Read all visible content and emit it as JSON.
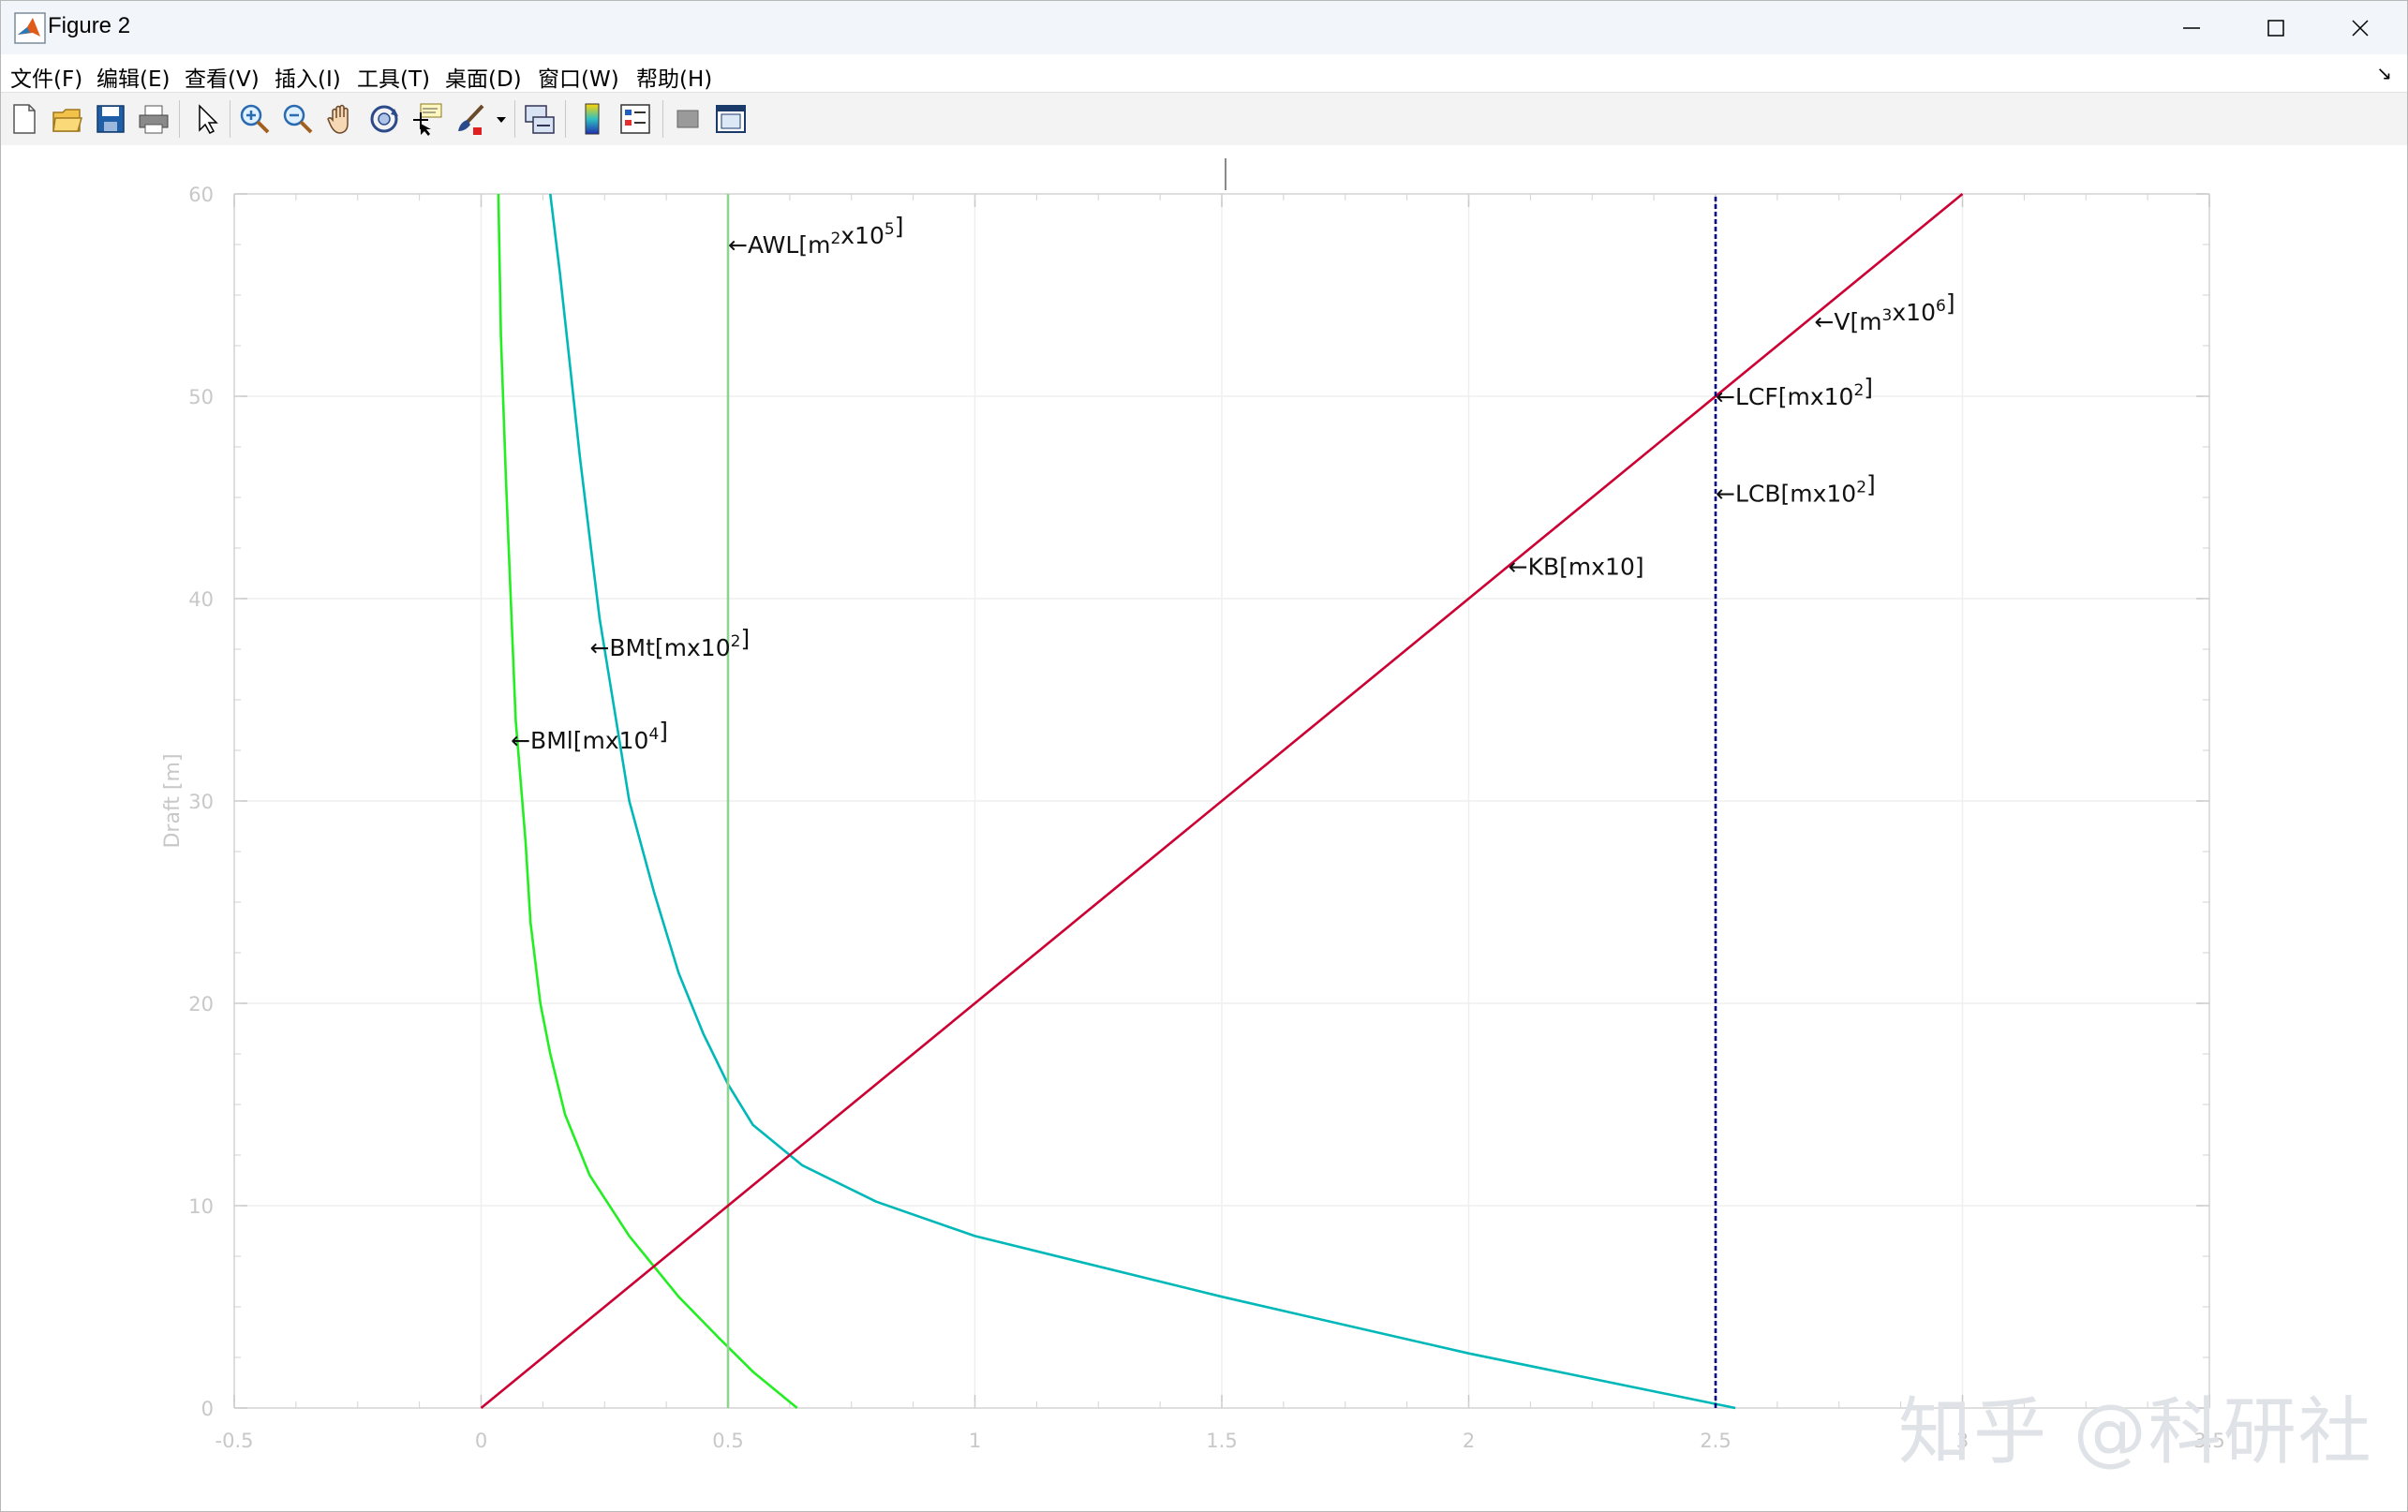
{
  "window": {
    "title": "Figure 2"
  },
  "menu": {
    "items": [
      "文件(F)",
      "编辑(E)",
      "查看(V)",
      "插入(I)",
      "工具(T)",
      "桌面(D)",
      "窗口(W)",
      "帮助(H)"
    ]
  },
  "toolbar": {
    "buttons": [
      {
        "name": "new-figure-icon"
      },
      {
        "name": "open-file-icon"
      },
      {
        "name": "save-icon"
      },
      {
        "name": "print-icon"
      },
      {
        "name": "edit-plot-arrow-icon"
      },
      {
        "name": "zoom-in-icon"
      },
      {
        "name": "zoom-out-icon"
      },
      {
        "name": "pan-hand-icon"
      },
      {
        "name": "rotate-3d-icon"
      },
      {
        "name": "data-cursor-icon"
      },
      {
        "name": "brush-icon"
      },
      {
        "name": "link-plot-icon"
      },
      {
        "name": "colorbar-icon"
      },
      {
        "name": "legend-icon"
      },
      {
        "name": "hide-tools-icon"
      },
      {
        "name": "show-tools-icon"
      }
    ]
  },
  "watermark": "知乎 @科研社",
  "chart_data": {
    "type": "line",
    "xlabel": "",
    "ylabel": "Draft [m]",
    "xlim": [
      -0.5,
      3.5
    ],
    "ylim": [
      0,
      60
    ],
    "xticks": [
      -0.5,
      0,
      0.5,
      1,
      1.5,
      2,
      2.5,
      3,
      3.5
    ],
    "xtick_labels": [
      "-0.5",
      "0",
      "0.5",
      "1",
      "1.5",
      "2",
      "2.5",
      "3",
      "3.5"
    ],
    "yticks": [
      0,
      10,
      20,
      30,
      40,
      50,
      60
    ],
    "ytick_labels": [
      "0",
      "10",
      "20",
      "30",
      "40",
      "50",
      "60"
    ],
    "grid": true,
    "series": [
      {
        "color": "#00b8b8",
        "x": [
          2.54,
          2.0,
          1.5,
          1.0,
          0.8,
          0.65,
          0.55,
          0.5,
          0.45,
          0.4,
          0.35,
          0.3,
          0.27,
          0.24,
          0.22,
          0.2,
          0.18,
          0.16,
          0.14
        ],
        "y": [
          0,
          2.7,
          5.5,
          8.5,
          10.2,
          12.0,
          14.0,
          16.0,
          18.5,
          21.5,
          25.5,
          30.0,
          34.5,
          39.0,
          43.0,
          47.0,
          51.5,
          56.0,
          60
        ]
      },
      {
        "color": "#22ee22",
        "x": [
          0.64,
          0.55,
          0.48,
          0.4,
          0.3,
          0.22,
          0.17,
          0.14,
          0.12,
          0.1,
          0.09,
          0.07,
          0.06,
          0.05,
          0.04,
          0.035
        ],
        "y": [
          0,
          1.8,
          3.5,
          5.5,
          8.5,
          11.5,
          14.5,
          17.5,
          20.0,
          24.0,
          28.0,
          34.0,
          40.0,
          46.0,
          53.0,
          60
        ]
      },
      {
        "color": "#8fd48f",
        "x": [
          0.5,
          0.5
        ],
        "y": [
          0,
          60
        ]
      },
      {
        "color": "#cc0033",
        "x": [
          0,
          3.0
        ],
        "y": [
          0,
          60
        ]
      },
      {
        "color": "#000080",
        "dashed": true,
        "x": [
          2.5,
          2.5
        ],
        "y": [
          0,
          60
        ]
      }
    ],
    "annotations": [
      {
        "base": "←AWL[m",
        "sup1": "2",
        "mid": "x10",
        "sup2": "5",
        "tail": "]",
        "x": 0.5,
        "y": 57.5
      },
      {
        "base": "←V[m",
        "sup1": "3",
        "mid": "x10",
        "sup2": "6",
        "tail": "]",
        "x": 2.7,
        "y": 53.7
      },
      {
        "base": "←LCF[mx10",
        "sup1": "",
        "mid": "",
        "sup2": "2",
        "tail": "]",
        "x": 2.5,
        "y": 50
      },
      {
        "base": "←LCB[mx10",
        "sup1": "",
        "mid": "",
        "sup2": "2",
        "tail": "]",
        "x": 2.5,
        "y": 45.2
      },
      {
        "base": "←KB[mx10]",
        "sup1": "",
        "mid": "",
        "sup2": "",
        "tail": "",
        "x": 2.08,
        "y": 41.6
      },
      {
        "base": "←BMt[mx10",
        "sup1": "",
        "mid": "",
        "sup2": "2",
        "tail": "]",
        "x": 0.22,
        "y": 37.6
      },
      {
        "base": "←BMl[mx10",
        "sup1": "",
        "mid": "",
        "sup2": "4",
        "tail": "]",
        "x": 0.06,
        "y": 33.0
      }
    ]
  }
}
